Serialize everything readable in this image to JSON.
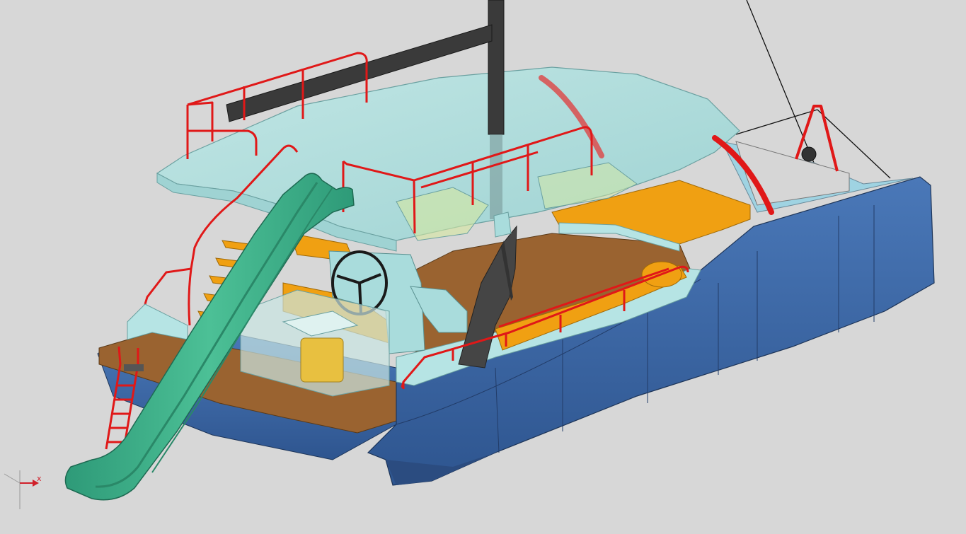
{
  "viewport": {
    "background": "#d7d7d7"
  },
  "colors": {
    "hull": "#3f68a8",
    "hull_dark": "#2f5390",
    "deck_wood": "#9a6330",
    "cabin_glass": "#a9dcdc",
    "railing": "#e01818",
    "cushion": "#f0a012",
    "slide": "#38a884",
    "mast": "#3a3a3a"
  },
  "triad": {
    "x_label": "x"
  }
}
